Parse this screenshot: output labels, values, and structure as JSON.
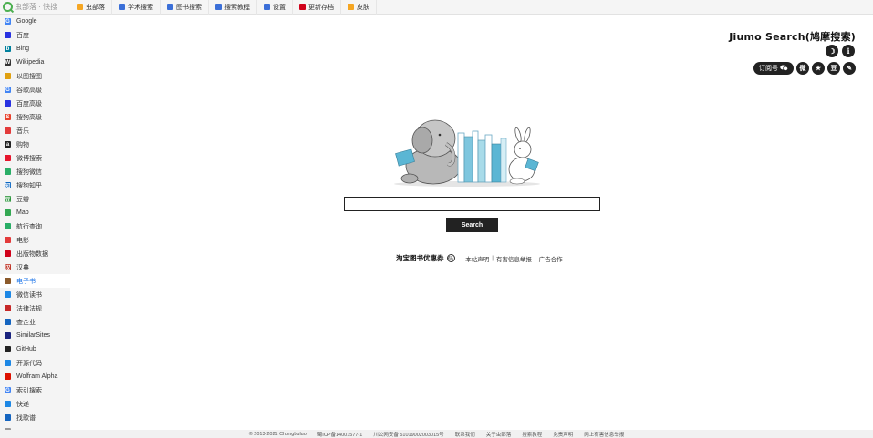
{
  "brand": {
    "name": "虫部落 · 快搜"
  },
  "topnav": [
    {
      "label": "虫部落",
      "icon": "bulb-icon",
      "color": "#f5a623"
    },
    {
      "label": "学术搜索",
      "icon": "cap-icon",
      "color": "#3b6fd8"
    },
    {
      "label": "图书搜索",
      "icon": "book-icon",
      "color": "#3b6fd8"
    },
    {
      "label": "搜索教程",
      "icon": "doc-icon",
      "color": "#3b6fd8"
    },
    {
      "label": "设置",
      "icon": "gear-icon",
      "color": "#3b6fd8"
    },
    {
      "label": "更新存档",
      "icon": "archive-icon",
      "color": "#d0021b"
    },
    {
      "label": "皮肤",
      "icon": "palette-icon",
      "color": "#f5a623"
    }
  ],
  "sidebar": [
    {
      "label": "Google",
      "color": "#4285f4",
      "glyph": "G"
    },
    {
      "label": "百度",
      "color": "#2932e1",
      "glyph": ""
    },
    {
      "label": "Bing",
      "color": "#00809d",
      "glyph": "b"
    },
    {
      "label": "Wikipedia",
      "color": "#333333",
      "glyph": "W"
    },
    {
      "label": "以图搜图",
      "color": "#e0a010",
      "glyph": ""
    },
    {
      "label": "谷歌高级",
      "color": "#4285f4",
      "glyph": "G"
    },
    {
      "label": "百度高级",
      "color": "#2932e1",
      "glyph": ""
    },
    {
      "label": "搜狗高级",
      "color": "#e8412c",
      "glyph": "S"
    },
    {
      "label": "音乐",
      "color": "#e33b3b",
      "glyph": ""
    },
    {
      "label": "购物",
      "color": "#222222",
      "glyph": "a"
    },
    {
      "label": "微博搜索",
      "color": "#e6162d",
      "glyph": ""
    },
    {
      "label": "搜狗微信",
      "color": "#2aae67",
      "glyph": ""
    },
    {
      "label": "搜狗知乎",
      "color": "#0a66c2",
      "glyph": "知"
    },
    {
      "label": "豆瓣",
      "color": "#2e963d",
      "glyph": "豆"
    },
    {
      "label": "Map",
      "color": "#34a853",
      "glyph": ""
    },
    {
      "label": "航行查询",
      "color": "#2aae67",
      "glyph": ""
    },
    {
      "label": "电影",
      "color": "#e33b3b",
      "glyph": ""
    },
    {
      "label": "出版物数据",
      "color": "#d0021b",
      "glyph": ""
    },
    {
      "label": "汉典",
      "color": "#c0392b",
      "glyph": "汉"
    },
    {
      "label": "电子书",
      "color": "#8b5a2b",
      "glyph": ""
    },
    {
      "label": "微信读书",
      "color": "#1e88e5",
      "glyph": ""
    },
    {
      "label": "法律法规",
      "color": "#c62828",
      "glyph": ""
    },
    {
      "label": "查企业",
      "color": "#1565c0",
      "glyph": ""
    },
    {
      "label": "SimilarSites",
      "color": "#1a237e",
      "glyph": ""
    },
    {
      "label": "GitHub",
      "color": "#222222",
      "glyph": ""
    },
    {
      "label": "开源代码",
      "color": "#1e88e5",
      "glyph": ""
    },
    {
      "label": "Wolfram Alpha",
      "color": "#dd1100",
      "glyph": ""
    },
    {
      "label": "索引搜索",
      "color": "#4285f4",
      "glyph": "G"
    },
    {
      "label": "快递",
      "color": "#1e88e5",
      "glyph": ""
    },
    {
      "label": "找歌谱",
      "color": "#1565c0",
      "glyph": ""
    },
    {
      "label": "",
      "color": "#999999",
      "glyph": ""
    }
  ],
  "sidebar_active": "电子书",
  "header": {
    "title": "Jiumo Search(鸠摩搜索)",
    "moon_glyph": "☽",
    "info_glyph": "i",
    "subscribe_label": "订阅号",
    "social": [
      {
        "name": "weibo-icon",
        "glyph": "微"
      },
      {
        "name": "star-icon",
        "glyph": "★"
      },
      {
        "name": "douban-icon",
        "glyph": "豆"
      },
      {
        "name": "chat-icon",
        "glyph": "✎"
      }
    ]
  },
  "search": {
    "value": "",
    "placeholder": "",
    "button_label": "Search"
  },
  "links": {
    "taobao": "淘宝图书优惠券",
    "qr_glyph": "码",
    "items": [
      "本站声明",
      "有害信息举报",
      "广告合作"
    ]
  },
  "footer": {
    "items": [
      "© 2013-2021 Chongbuluo",
      "蜀ICP备14001577-1",
      "川公网安备 51019002003015号",
      "联系我们",
      "关于虫部落",
      "搜索教程",
      "免责声明",
      "网上有害信息举报"
    ]
  }
}
